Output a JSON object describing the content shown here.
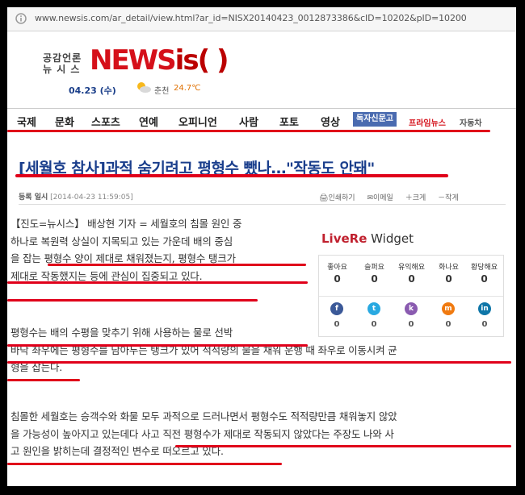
{
  "browser": {
    "url": "www.newsis.com/ar_detail/view.html?ar_id=NISX20140423_0012873386&cID=10202&pID=10200"
  },
  "header": {
    "logo_korean_line1": "공감언론",
    "logo_korean_line2": "뉴 시 스",
    "logo_news": "NEWS",
    "logo_is": "is( )",
    "date": "04.23 (수)",
    "weather_city": "춘천",
    "weather_temp": "24.7℃"
  },
  "nav": {
    "items": [
      "국제",
      "문화",
      "스포츠",
      "연예",
      "오피니언",
      "사람",
      "포토",
      "영상"
    ],
    "badge": "독자신문고",
    "premium": "프라임뉴스",
    "auto": "자동차"
  },
  "article": {
    "title": "[세월호 참사]과적 숨기려고 평형수 뺐나…\"작동도 안돼\"",
    "byline_label": "등록 일시",
    "byline_date": "[2014-04-23 11:59:05]",
    "tools": [
      "인쇄하기",
      "이메일",
      "크게",
      "작게"
    ],
    "paragraphs": [
      [
        "【진도=뉴시스】 배상현 기자 = 세월호의 침몰 원인 중",
        "하나로 복원력 상실이 지목되고 있는 가운데 배의 중심",
        "을 잡는 평형수 양이 제대로 채워졌는지, 평형수 탱크가",
        "제대로 작동했지는 등에 관심이 집중되고 있다."
      ],
      [
        "평형수는 배의 수평을 맞추기 위해 사용하는 물로 선박",
        "바닥 좌우에는 평형수를 담아두는 탱크가 있어 적적량의 물을 채워 운행 때 좌우로 이동시켜 균",
        "형을 잡는다."
      ],
      [
        "침몰한 세월호는 승객수와 화물 모두 과적으로 드러나면서 평형수도 적적량만큼 채워놓지 않았",
        "을 가능성이 높아지고 있는데다 사고 직전 평형수가 제대로 작동되지 않았다는 주장도 나와 사",
        "고 원인을 밝히는데 결정적인 변수로 떠오르고 있다."
      ]
    ]
  },
  "widget": {
    "brand_red": "LiveRe",
    "brand_rest": " Widget",
    "reactions": [
      {
        "label": "좋아요",
        "count": "0"
      },
      {
        "label": "슬퍼요",
        "count": "0"
      },
      {
        "label": "유익해요",
        "count": "0"
      },
      {
        "label": "화나요",
        "count": "0"
      },
      {
        "label": "황당해요",
        "count": "0"
      }
    ],
    "shares": [
      {
        "icon": "facebook-icon",
        "glyph": "f",
        "color": "#3b5998",
        "count": "0"
      },
      {
        "icon": "twitter-icon",
        "glyph": "t",
        "color": "#29a9e1",
        "count": "0"
      },
      {
        "icon": "kakao-icon",
        "glyph": "k",
        "color": "#8a5bb0",
        "count": "0"
      },
      {
        "icon": "me2day-icon",
        "glyph": "m",
        "color": "#f07a10",
        "count": "0"
      },
      {
        "icon": "linkedin-icon",
        "glyph": "in",
        "color": "#0e76a8",
        "count": "0"
      }
    ]
  },
  "colors": {
    "highlight_line": "#e0001a",
    "title": "#1a3e8c",
    "brand_red": "#d5101a"
  }
}
